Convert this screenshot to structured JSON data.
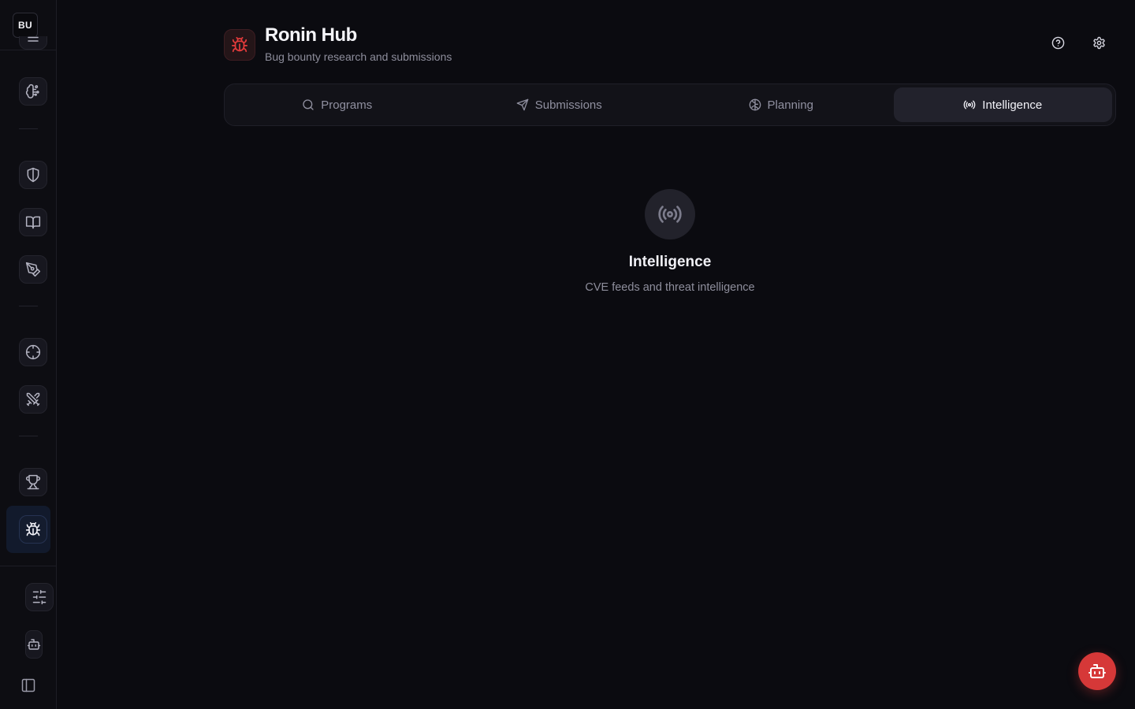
{
  "sidebar": {
    "workspace_badge": "BU",
    "items": [
      {
        "icon": "dashboard-icon"
      },
      {
        "icon": "brain-circuit-icon"
      },
      {
        "icon": "shield-icon"
      },
      {
        "icon": "book-open-icon"
      },
      {
        "icon": "pen-tool-icon"
      },
      {
        "icon": "crosshair-icon"
      },
      {
        "icon": "swords-icon"
      },
      {
        "icon": "trophy-icon"
      },
      {
        "icon": "bug-icon",
        "active": true
      }
    ],
    "bottom": [
      {
        "icon": "sliders-icon"
      },
      {
        "icon": "bot-icon"
      },
      {
        "icon": "panel-left-icon"
      }
    ]
  },
  "header": {
    "title": "Ronin Hub",
    "subtitle": "Bug bounty research and submissions",
    "logo_icon": "bug-icon",
    "actions": [
      "help-icon",
      "settings-icon"
    ]
  },
  "tabs": [
    {
      "label": "Programs",
      "icon": "search-icon",
      "active": false
    },
    {
      "label": "Submissions",
      "icon": "send-icon",
      "active": false
    },
    {
      "label": "Planning",
      "icon": "brain-icon",
      "active": false
    },
    {
      "label": "Intelligence",
      "icon": "radio-icon",
      "active": true
    }
  ],
  "content": {
    "icon": "radio-icon",
    "title": "Intelligence",
    "description": "CVE feeds and threat intelligence"
  },
  "fab": {
    "icon": "bot-icon"
  },
  "colors": {
    "background": "#0b0b10",
    "accent": "#d63838",
    "active_nav": "#121a2c"
  }
}
